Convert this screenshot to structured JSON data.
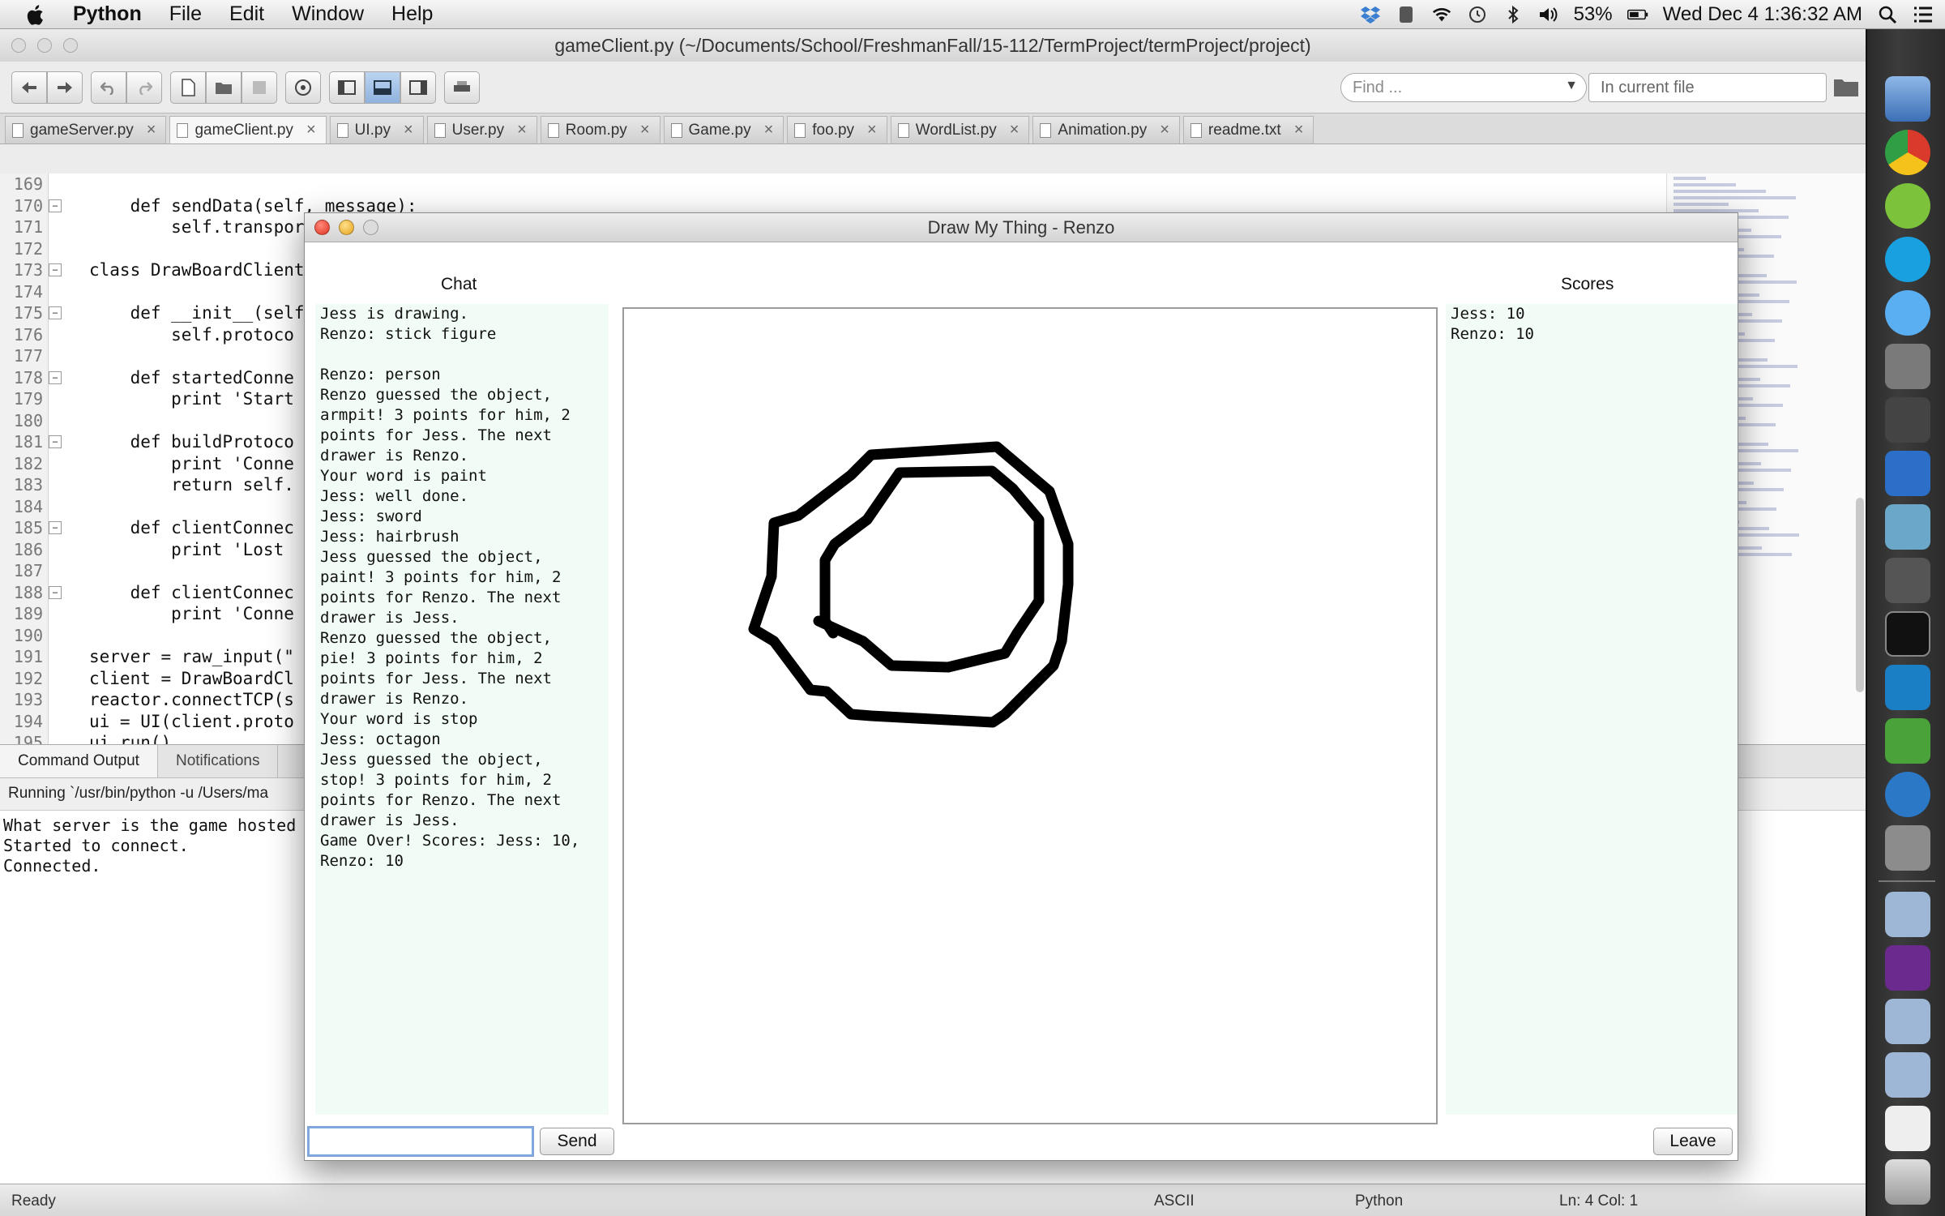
{
  "menubar": {
    "app": "Python",
    "items": [
      "File",
      "Edit",
      "Window",
      "Help"
    ],
    "battery": "53%",
    "clock": "Wed Dec 4  1:36:32 AM"
  },
  "editor": {
    "title": "gameClient.py (~/Documents/School/FreshmanFall/15-112/TermProject/termProject/project)",
    "find_placeholder": "Find ...",
    "scope": "In current file",
    "tabs": [
      {
        "label": "gameServer.py",
        "active": false
      },
      {
        "label": "gameClient.py",
        "active": true
      },
      {
        "label": "UI.py",
        "active": false
      },
      {
        "label": "User.py",
        "active": false
      },
      {
        "label": "Room.py",
        "active": false
      },
      {
        "label": "Game.py",
        "active": false
      },
      {
        "label": "foo.py",
        "active": false
      },
      {
        "label": "WordList.py",
        "active": false
      },
      {
        "label": "Animation.py",
        "active": false
      },
      {
        "label": "readme.txt",
        "active": false
      }
    ],
    "line_numbers": [
      "169",
      "170",
      "171",
      "172",
      "173",
      "174",
      "175",
      "176",
      "177",
      "178",
      "179",
      "180",
      "181",
      "182",
      "183",
      "184",
      "185",
      "186",
      "187",
      "188",
      "189",
      "190",
      "191",
      "192",
      "193",
      "194",
      "195"
    ],
    "code_lines": [
      "",
      "    def sendData(self, message):",
      "        self.transport.write(message + \"\\r\\n\")",
      "",
      "class DrawBoardClient",
      "",
      "    def __init__(self",
      "        self.protoco",
      "",
      "    def startedConne",
      "        print 'Start",
      "",
      "    def buildProtoco",
      "        print 'Conne",
      "        return self.",
      "",
      "    def clientConnec",
      "        print 'Lost",
      "",
      "    def clientConnec",
      "        print 'Conne",
      "",
      "server = raw_input(\"",
      "client = DrawBoardCl",
      "reactor.connectTCP(s",
      "ui = UI(client.proto",
      "ui.run()"
    ],
    "output_tabs": [
      "Command Output",
      "Notifications"
    ],
    "running": "Running `/usr/bin/python -u /Users/ma",
    "output_lines": [
      "What server is the game hosted",
      "Started to connect.",
      "Connected."
    ],
    "status": {
      "left": "Ready",
      "encoding": "ASCII",
      "language": "Python",
      "position": "Ln: 4 Col: 1"
    }
  },
  "game": {
    "title": "Draw My Thing - Renzo",
    "chat_heading": "Chat",
    "scores_heading": "Scores",
    "chat_lines": [
      "Jess is drawing.",
      "Renzo: stick figure",
      "",
      "Renzo: person",
      "Renzo guessed the object,",
      "armpit! 3 points for him, 2",
      "points for Jess. The next",
      "drawer is Renzo.",
      "Your word is paint",
      "Jess: well done.",
      "Jess: sword",
      "Jess: hairbrush",
      "Jess guessed the object,",
      "paint! 3 points for him, 2",
      "points for Renzo. The next",
      "drawer is Jess.",
      "Renzo guessed the object,",
      "pie! 3 points for him, 2",
      "points for Jess. The next",
      "drawer is Renzo.",
      "Your word is stop",
      "Jess: octagon",
      "Jess guessed the object,",
      "stop! 3 points for him, 2",
      "points for Renzo. The next",
      "drawer is Jess.",
      "Game Over! Scores: Jess: 10,",
      "Renzo: 10"
    ],
    "scores": [
      "Jess: 10",
      "Renzo: 10"
    ],
    "input_value": "",
    "send_label": "Send",
    "leave_label": "Leave"
  },
  "colors": {
    "chat_bg": "#f1fcf6",
    "keyword": "#1f2fb8",
    "function": "#0d7f5a",
    "close_red": "#e0301f",
    "minimize_yellow": "#e6a21a"
  }
}
